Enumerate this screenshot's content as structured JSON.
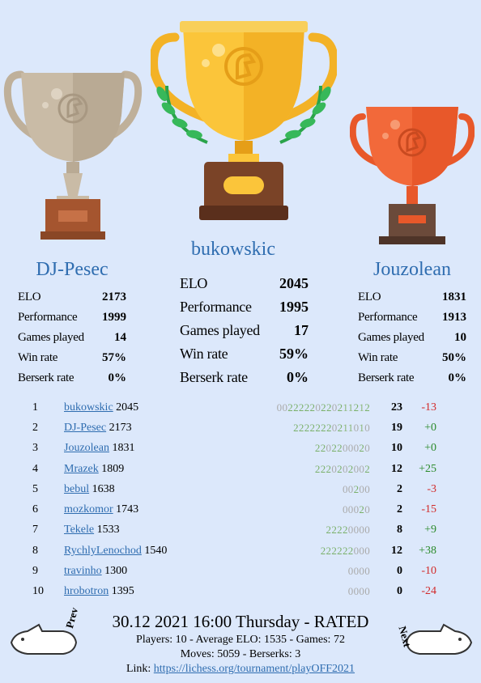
{
  "podium": [
    {
      "place": 2,
      "name": "DJ-Pesec",
      "elo": "2173",
      "performance": "1999",
      "games": "14",
      "winrate": "57%",
      "berserk": "0%"
    },
    {
      "place": 1,
      "name": "bukowskic",
      "elo": "2045",
      "performance": "1995",
      "games": "17",
      "winrate": "59%",
      "berserk": "0%"
    },
    {
      "place": 3,
      "name": "Jouzolean",
      "elo": "1831",
      "performance": "1913",
      "games": "10",
      "winrate": "50%",
      "berserk": "0%"
    }
  ],
  "labels": {
    "elo": "ELO",
    "performance": "Performance",
    "games": "Games played",
    "winrate": "Win rate",
    "berserk": "Berserk rate"
  },
  "standings": [
    {
      "rank": "1",
      "name": "bukowskic",
      "rating": "2045",
      "sequence": "00222220220211212",
      "points": "23",
      "diff": "-13"
    },
    {
      "rank": "2",
      "name": "DJ-Pesec",
      "rating": "2173",
      "sequence": "22222220211010",
      "points": "19",
      "diff": "+0"
    },
    {
      "rank": "3",
      "name": "Jouzolean",
      "rating": "1831",
      "sequence": "2202200020",
      "points": "10",
      "diff": "+0"
    },
    {
      "rank": "4",
      "name": "Mrazek",
      "rating": "1809",
      "sequence": "2220202002",
      "points": "12",
      "diff": "+25"
    },
    {
      "rank": "5",
      "name": "bebul",
      "rating": "1638",
      "sequence": "00200",
      "points": "2",
      "diff": "-3"
    },
    {
      "rank": "6",
      "name": "mozkomor",
      "rating": "1743",
      "sequence": "00020",
      "points": "2",
      "diff": "-15"
    },
    {
      "rank": "7",
      "name": "Tekele",
      "rating": "1533",
      "sequence": "22220000",
      "points": "8",
      "diff": "+9"
    },
    {
      "rank": "8",
      "name": "RychlyLenochod",
      "rating": "1540",
      "sequence": "222222000",
      "points": "12",
      "diff": "+38"
    },
    {
      "rank": "9",
      "name": "travinho",
      "rating": "1300",
      "sequence": "0000",
      "points": "0",
      "diff": "-10"
    },
    {
      "rank": "10",
      "name": "hrobotron",
      "rating": "1395",
      "sequence": "0000",
      "points": "0",
      "diff": "-24"
    }
  ],
  "footer": {
    "headline": "30.12 2021 16:00 Thursday - RATED",
    "line1": "Players: 10 - Average ELO: 1535 - Games: 72",
    "line2": "Moves: 5059 - Berserks: 3",
    "link_label": "Link: ",
    "link_url": "https://lichess.org/tournament/playOFF2021"
  },
  "nav": {
    "prev": "Prev",
    "next": "Next"
  },
  "colors": {
    "background": "#dce8fb",
    "name": "#2f6db0",
    "positive": "#2a8a2a",
    "negative": "#d22a2a",
    "gold": "#f7be2f",
    "silver": "#c9bba6",
    "bronze": "#f2693a"
  }
}
